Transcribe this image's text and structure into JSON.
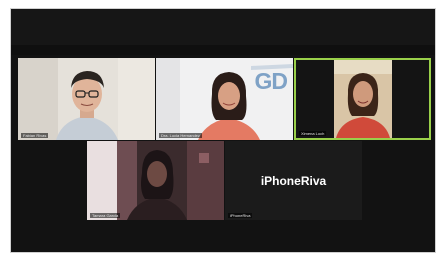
{
  "meeting": {
    "participants": [
      {
        "name": "Fabian Rivas",
        "initials": ""
      },
      {
        "name": "Dra. Lucia Hernandez"
      },
      {
        "name": "Ximena Loch"
      },
      {
        "name": "Tamara Garcia"
      },
      {
        "name": "iPhoneRiva",
        "label": "iPhoneRiva"
      }
    ],
    "wall_logo": "GD",
    "colors": {
      "active_speaker_border": "#9ad04a",
      "background": "#121212"
    }
  }
}
